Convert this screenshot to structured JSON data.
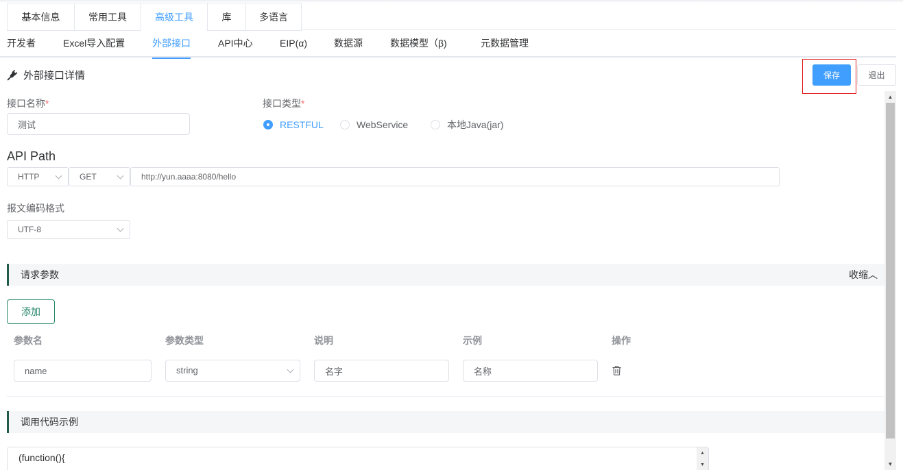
{
  "top_tabs": [
    {
      "label": "基本信息",
      "active": false
    },
    {
      "label": "常用工具",
      "active": false
    },
    {
      "label": "高级工具",
      "active": true
    },
    {
      "label": "库",
      "active": false
    },
    {
      "label": "多语言",
      "active": false
    }
  ],
  "sub_tabs": [
    {
      "label": "开发者",
      "active": false
    },
    {
      "label": "Excel导入配置",
      "active": false
    },
    {
      "label": "外部接口",
      "active": true
    },
    {
      "label": "API中心",
      "active": false
    },
    {
      "label": "EIP(α)",
      "active": false
    },
    {
      "label": "数据源",
      "active": false
    },
    {
      "label": "数据模型（β)",
      "active": false
    },
    {
      "label": "元数据管理",
      "active": false
    }
  ],
  "header": {
    "title": "外部接口详情",
    "icon": "plug-icon",
    "save_label": "保存",
    "exit_label": "退出"
  },
  "form": {
    "name_label": "接口名称",
    "name_value": "测试",
    "type_label": "接口类型",
    "type_options": [
      {
        "label": "RESTFUL",
        "checked": true
      },
      {
        "label": "WebService",
        "checked": false
      },
      {
        "label": "本地Java(jar)",
        "checked": false
      }
    ],
    "api_path_title": "API Path",
    "protocol": "HTTP",
    "method": "GET",
    "url": "http://yun.aaaa:8080/hello",
    "encoding_label": "报文编码格式",
    "encoding_value": "UTF-8"
  },
  "request_params": {
    "title": "请求参数",
    "collapse_label": "收缩",
    "add_label": "添加",
    "columns": [
      "参数名",
      "参数类型",
      "说明",
      "示例",
      "操作"
    ],
    "rows": [
      {
        "name": "name",
        "type": "string",
        "desc": "名字",
        "example": "名称"
      }
    ]
  },
  "code_example": {
    "title": "调用代码示例",
    "code": "(function(){"
  },
  "colors": {
    "primary": "#409eff",
    "accent_green": "#26866a",
    "section_border": "#1f5a4a",
    "required": "#f56c6c",
    "highlight": "#e02020"
  }
}
